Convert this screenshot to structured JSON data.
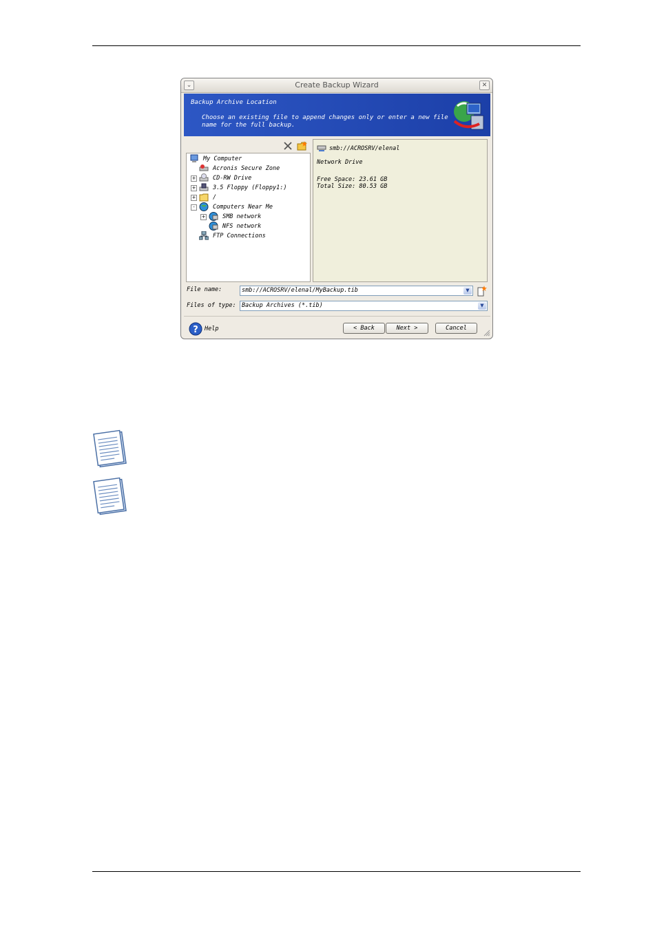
{
  "window": {
    "title": "Create Backup Wizard"
  },
  "banner": {
    "title": "Backup Archive Location",
    "description": "Choose an existing file to append changes only or enter a new file name for the full backup."
  },
  "toolbar": {
    "delete_icon": "delete-x-icon",
    "new_folder_icon": "new-folder-icon"
  },
  "tree": {
    "items": [
      {
        "label": "My Computer",
        "icon": "my-computer-icon"
      },
      {
        "label": "Acronis Secure Zone",
        "icon": "secure-zone-icon"
      },
      {
        "label": "CD-RW Drive",
        "icon": "cd-drive-icon",
        "expander": "+"
      },
      {
        "label": "3.5 Floppy (Floppy1:)",
        "icon": "floppy-icon",
        "expander": "+"
      },
      {
        "label": "/",
        "icon": "folder-icon",
        "expander": "+"
      },
      {
        "label": "Computers Near Me",
        "icon": "globe-icon",
        "expander": "-"
      },
      {
        "label": "SMB network",
        "icon": "network-icon",
        "expander": "+"
      },
      {
        "label": "NFS network",
        "icon": "network-icon"
      },
      {
        "label": "FTP Connections",
        "icon": "ftp-icon"
      }
    ]
  },
  "info": {
    "path": "smb://ACROSRV/elenal",
    "type": "Network Drive",
    "free_space": "Free Space: 23.61 GB",
    "total_size": "Total Size: 80.53 GB"
  },
  "form": {
    "file_name_label": "File name:",
    "file_name_value": "smb://ACROSRV/elenal/MyBackup.tib",
    "file_type_label": "Files of type:",
    "file_type_value": "Backup Archives (*.tib)"
  },
  "buttons": {
    "help": "Help",
    "back": "< Back",
    "next": "Next >",
    "cancel": "Cancel"
  },
  "colors": {
    "banner": "#2d57c4",
    "info_bg": "#f0efdc",
    "window_bg": "#efebe3"
  }
}
